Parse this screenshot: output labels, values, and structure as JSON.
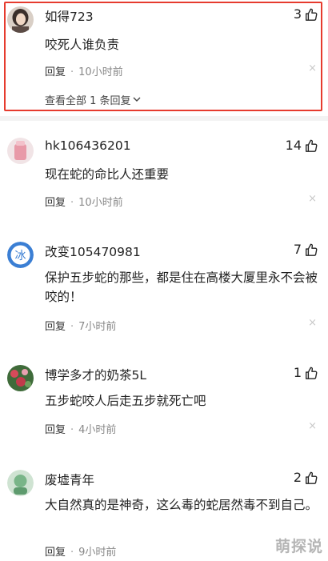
{
  "comments": [
    {
      "username": "如得723",
      "content": "咬死人谁负责",
      "likes": "3",
      "reply_label": "回复",
      "dot": "·",
      "time": "10小时前",
      "view_all": "查看全部 1 条回复",
      "avatar_icon": "avatar-girl-icon"
    },
    {
      "username": "hk106436201",
      "content": "现在蛇的命比人还重要",
      "likes": "14",
      "reply_label": "回复",
      "dot": "·",
      "time": "10小时前",
      "avatar_icon": "avatar-pink-icon"
    },
    {
      "username": "改变105470981",
      "content": "保护五步蛇的那些，都是住在高楼大厦里永不会被咬的！",
      "likes": "7",
      "reply_label": "回复",
      "dot": "·",
      "time": "7小时前",
      "avatar_icon": "avatar-blue-ice-icon",
      "avatar_text": "冰"
    },
    {
      "username": "博学多才的奶茶5L",
      "content": "五步蛇咬人后走五步就死亡吧",
      "likes": "1",
      "reply_label": "回复",
      "dot": "·",
      "time": "4小时前",
      "avatar_icon": "avatar-flowers-icon"
    },
    {
      "username": "废墟青年",
      "content": "大自然真的是神奇，这么毒的蛇居然毒不到自己。",
      "likes": "2",
      "reply_label": "回复",
      "dot": "·",
      "time": "9小时前",
      "avatar_icon": "avatar-green-icon"
    }
  ],
  "close_glyph": "×",
  "chevron_glyph": "⌄",
  "highlight_color": "#e63b2e",
  "watermark": "萌探说"
}
